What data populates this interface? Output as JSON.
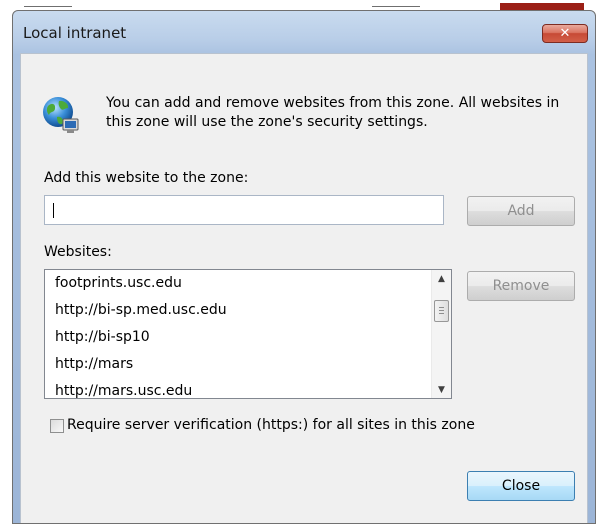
{
  "dialog": {
    "title": "Local intranet",
    "close_glyph": "✕",
    "intro_text": "You can add and remove websites from this zone. All websites in this zone will use the zone's security settings.",
    "add_label": "Add this website to the zone:",
    "add_input_value": "",
    "add_button": "Add",
    "websites_label": "Websites:",
    "websites": [
      "footprints.usc.edu",
      "http://bi-sp.med.usc.edu",
      "http://bi-sp10",
      "http://mars",
      "http://mars.usc.edu"
    ],
    "remove_button": "Remove",
    "require_https_label": "Require server verification (https:) for all sites in this zone",
    "require_https_checked": false,
    "close_button": "Close"
  },
  "icons": {
    "zone": "globe-computer-icon",
    "scroll_up": "▲",
    "scroll_down": "▼"
  },
  "colors": {
    "title_gradient_top": "#c9dbef",
    "client_background": "#f0f0f0",
    "close_button_red": "#c74a35",
    "default_button_border": "#3c7fb1"
  }
}
